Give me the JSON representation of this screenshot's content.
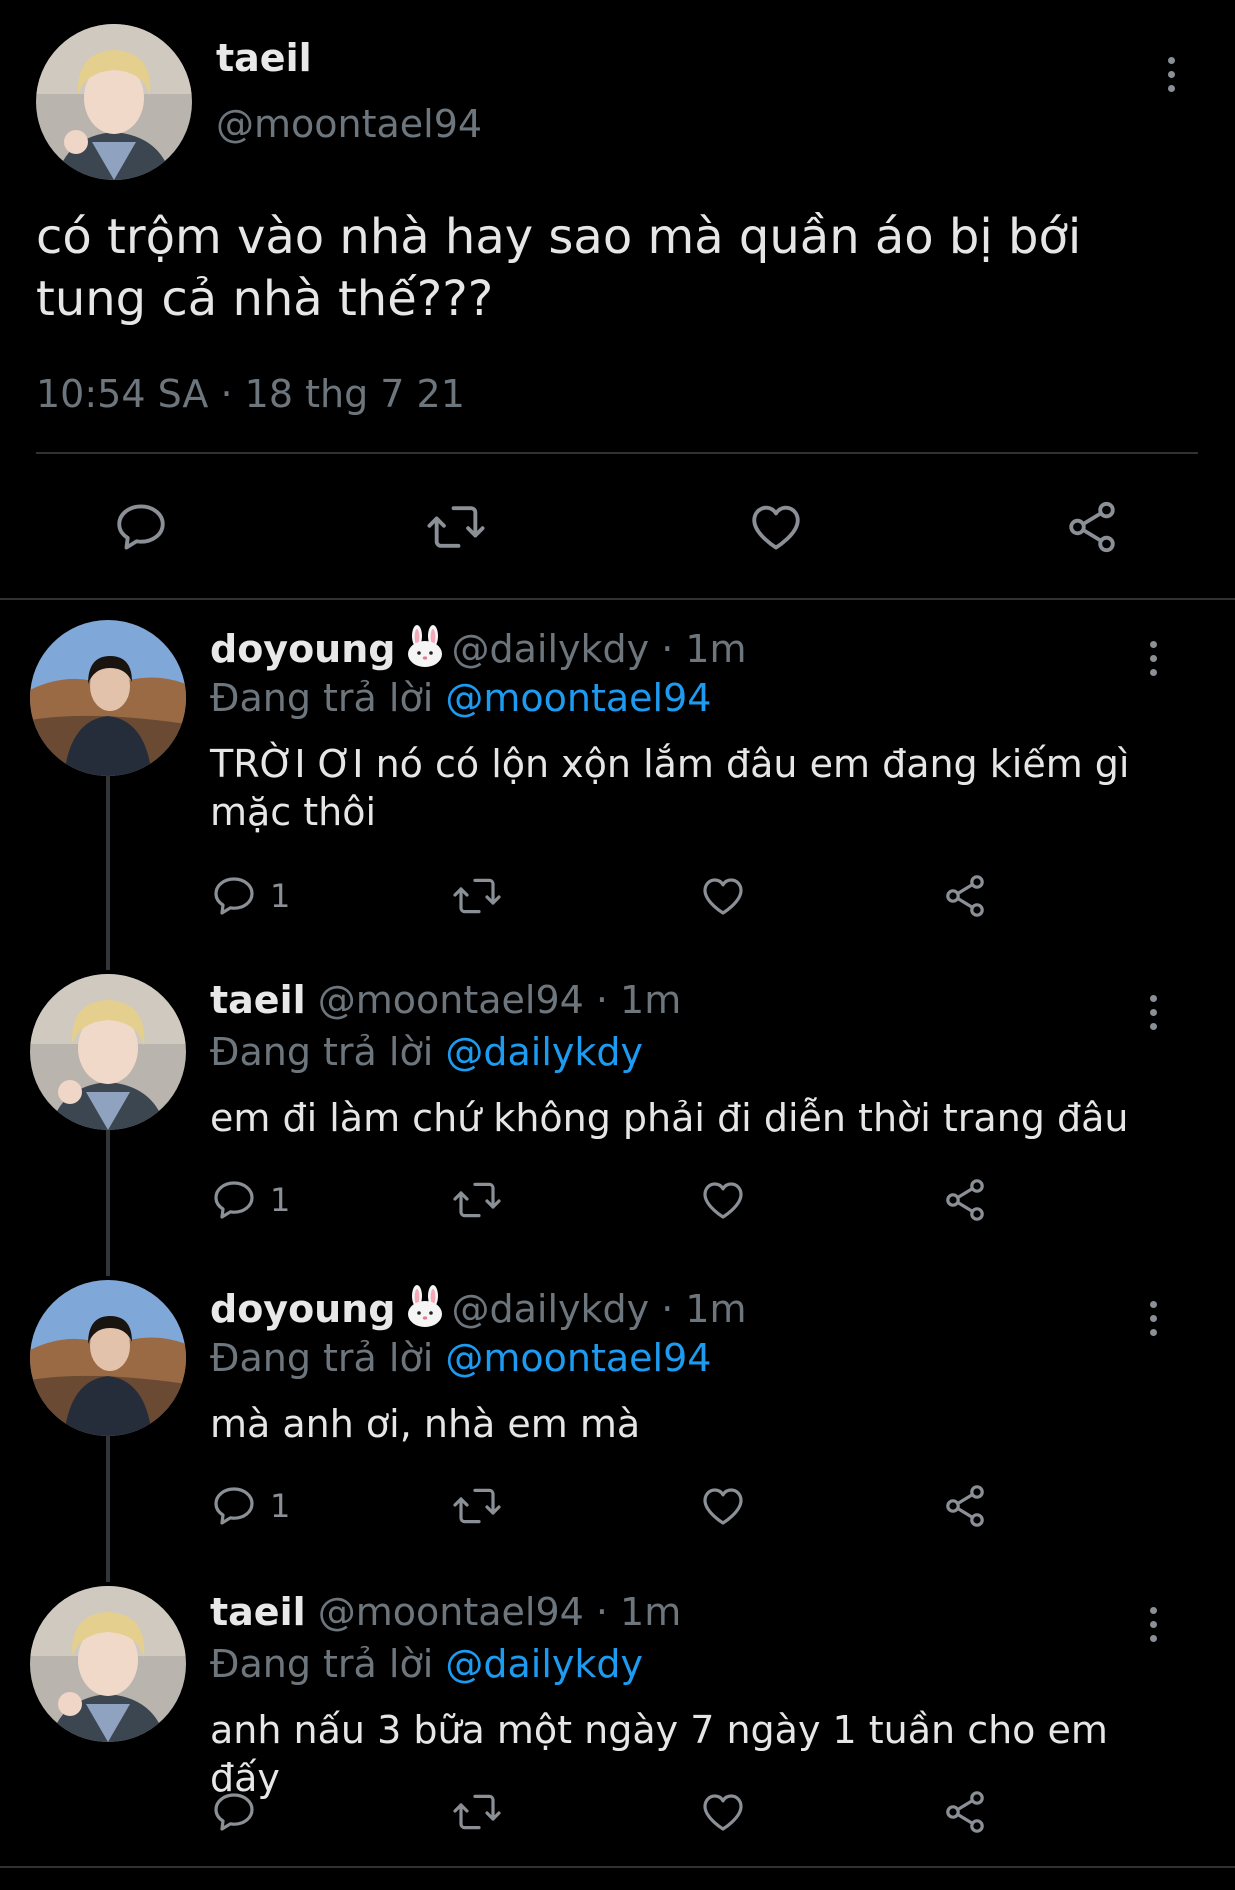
{
  "main": {
    "name": "taeil",
    "handle": "@moontael94",
    "text": "có trộm vào nhà hay sao mà quần áo bị bới tung cả nhà thế???",
    "time": "10:54 SA · 18 thg 7 21"
  },
  "colors": {
    "background": "#000000",
    "muted": "#6e767d",
    "link": "#1d9bf0",
    "divider": "#2f3336"
  },
  "icons": [
    "reply-icon",
    "retweet-icon",
    "like-icon",
    "share-icon",
    "more-icon",
    "rabbit-emoji-icon"
  ],
  "replies": [
    {
      "name": "doyoung",
      "emoji": "🐰",
      "meta": "@dailykdy · 1m",
      "replying_label": "Đang trả lời",
      "mention": "@moontael94",
      "text": "TRỜI ƠI nó có lộn xộn lắm đâu em đang kiếm gì mặc thôi",
      "reply_count": "1"
    },
    {
      "name": "taeil",
      "emoji": "",
      "meta": "@moontael94 · 1m",
      "replying_label": "Đang trả lời",
      "mention": "@dailykdy",
      "text": "em đi làm chứ không phải đi diễn thời trang đâu",
      "reply_count": "1"
    },
    {
      "name": "doyoung",
      "emoji": "🐰",
      "meta": "@dailykdy · 1m",
      "replying_label": "Đang trả lời",
      "mention": "@moontael94",
      "text": "mà anh ơi, nhà em mà",
      "reply_count": "1"
    },
    {
      "name": "taeil",
      "emoji": "",
      "meta": "@moontael94 · 1m",
      "replying_label": "Đang trả lời",
      "mention": "@dailykdy",
      "text": "anh nấu 3 bữa một ngày 7 ngày 1 tuần cho em đấy",
      "reply_count": ""
    }
  ]
}
